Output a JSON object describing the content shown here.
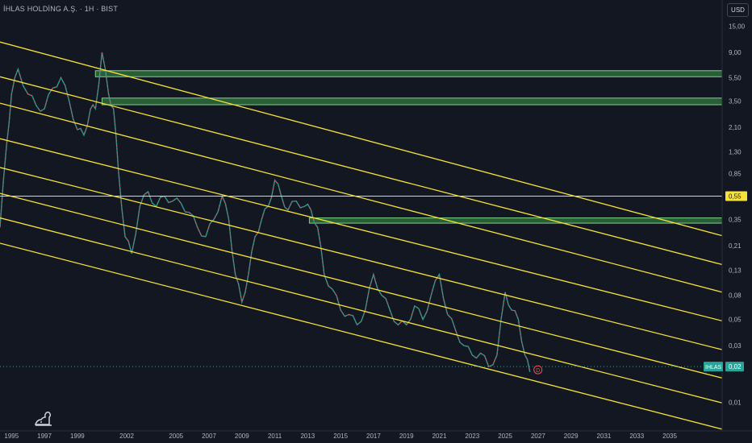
{
  "header": {
    "title": "İHLAS HOLDİNG A.Ş. · 1H · BIST",
    "currency": "USD"
  },
  "icons": {
    "logo": "tradingview-logo-icon"
  },
  "colors": {
    "background": "#131722",
    "trendline": "#f7e23b",
    "zone_fill": "#2e6b3a",
    "zone_border": "#7fd08a",
    "up_candle": "#26a69a",
    "down_candle": "#ef5350",
    "axis_text": "#b2b5be",
    "price_badge": "#26a69a"
  },
  "chart_data": {
    "type": "line",
    "scale": "log",
    "x_axis_ticks": [
      "1995",
      "1997",
      "1999",
      "2002",
      "2005",
      "2007",
      "2009",
      "2011",
      "2013",
      "2015",
      "2017",
      "2019",
      "2021",
      "2023",
      "2025",
      "2027",
      "2029",
      "2031",
      "2033",
      "2035"
    ],
    "y_axis_ticks": [
      "15,00",
      "9,00",
      "5,50",
      "3,50",
      "2,10",
      "1,30",
      "0,85",
      "0,55",
      "0,35",
      "0,21",
      "0,13",
      "0,08",
      "0,05",
      "0,03",
      "0,02",
      "0,01"
    ],
    "ylim": [
      0.006,
      20
    ],
    "xlim": [
      1994.3,
      2040
    ],
    "horizontal_line": {
      "value": 0.55,
      "label": "0,55"
    },
    "last_price": {
      "symbol": "IHLAS",
      "value": 0.02,
      "label": "0,02"
    },
    "event_marker": "D",
    "price_series_approx": {
      "x": [
        1994.3,
        1994.7,
        1995.0,
        1995.4,
        1996.0,
        1996.5,
        1997.0,
        1997.5,
        1998.0,
        1998.5,
        1999.0,
        1999.4,
        1999.8,
        2000.1,
        2000.5,
        2000.9,
        2001.2,
        2001.5,
        2001.9,
        2002.3,
        2002.8,
        2003.3,
        2003.8,
        2004.3,
        2004.8,
        2005.3,
        2005.8,
        2006.3,
        2006.8,
        2007.3,
        2007.8,
        2008.2,
        2008.6,
        2009.0,
        2009.4,
        2009.8,
        2010.2,
        2010.6,
        2011.0,
        2011.4,
        2011.8,
        2012.3,
        2012.8,
        2013.2,
        2013.6,
        2014.0,
        2014.5,
        2015.0,
        2015.5,
        2016.0,
        2016.5,
        2017.0,
        2017.5,
        2018.0,
        2018.5,
        2019.0,
        2019.5,
        2020.0,
        2020.5,
        2021.0,
        2021.5,
        2022.0,
        2022.5,
        2023.0,
        2023.5,
        2024.0,
        2024.5,
        2025.0,
        2025.4,
        2025.8,
        2026.2,
        2026.5
      ],
      "y": [
        0.3,
        1.5,
        4.0,
        6.5,
        4.0,
        3.2,
        3.0,
        4.5,
        5.5,
        3.5,
        2.0,
        1.8,
        3.0,
        3.0,
        9.0,
        4.0,
        3.0,
        0.9,
        0.25,
        0.18,
        0.45,
        0.6,
        0.45,
        0.55,
        0.5,
        0.48,
        0.4,
        0.3,
        0.25,
        0.35,
        0.55,
        0.35,
        0.12,
        0.07,
        0.12,
        0.25,
        0.35,
        0.45,
        0.75,
        0.55,
        0.42,
        0.5,
        0.45,
        0.42,
        0.3,
        0.12,
        0.09,
        0.06,
        0.055,
        0.045,
        0.06,
        0.12,
        0.08,
        0.06,
        0.045,
        0.045,
        0.065,
        0.05,
        0.08,
        0.12,
        0.055,
        0.04,
        0.03,
        0.025,
        0.026,
        0.02,
        0.025,
        0.085,
        0.06,
        0.05,
        0.025,
        0.018
      ]
    },
    "trendlines": [
      {
        "x": [
          1994.3,
          2040.0
        ],
        "y": [
          11.0,
          0.218
        ]
      },
      {
        "x": [
          1994.3,
          2040.0
        ],
        "y": [
          5.6,
          0.125
        ]
      },
      {
        "x": [
          1994.3,
          2040.0
        ],
        "y": [
          3.35,
          0.073
        ]
      },
      {
        "x": [
          1994.3,
          2040.0
        ],
        "y": [
          1.68,
          0.042
        ]
      },
      {
        "x": [
          1994.3,
          2040.0
        ],
        "y": [
          0.96,
          0.024
        ]
      },
      {
        "x": [
          1994.3,
          2040.0
        ],
        "y": [
          0.58,
          0.0138
        ]
      },
      {
        "x": [
          1994.3,
          2040.0
        ],
        "y": [
          0.36,
          0.0085
        ]
      },
      {
        "x": [
          1994.3,
          2040.0
        ],
        "y": [
          0.22,
          0.0051
        ]
      }
    ],
    "zones": [
      {
        "x": [
          2000.1,
          2041.3
        ],
        "y": [
          5.6,
          6.3
        ]
      },
      {
        "x": [
          2000.5,
          2042.3
        ],
        "y": [
          3.25,
          3.7
        ]
      },
      {
        "x": [
          2013.1,
          2041.3
        ],
        "y": [
          0.325,
          0.36
        ]
      }
    ]
  }
}
